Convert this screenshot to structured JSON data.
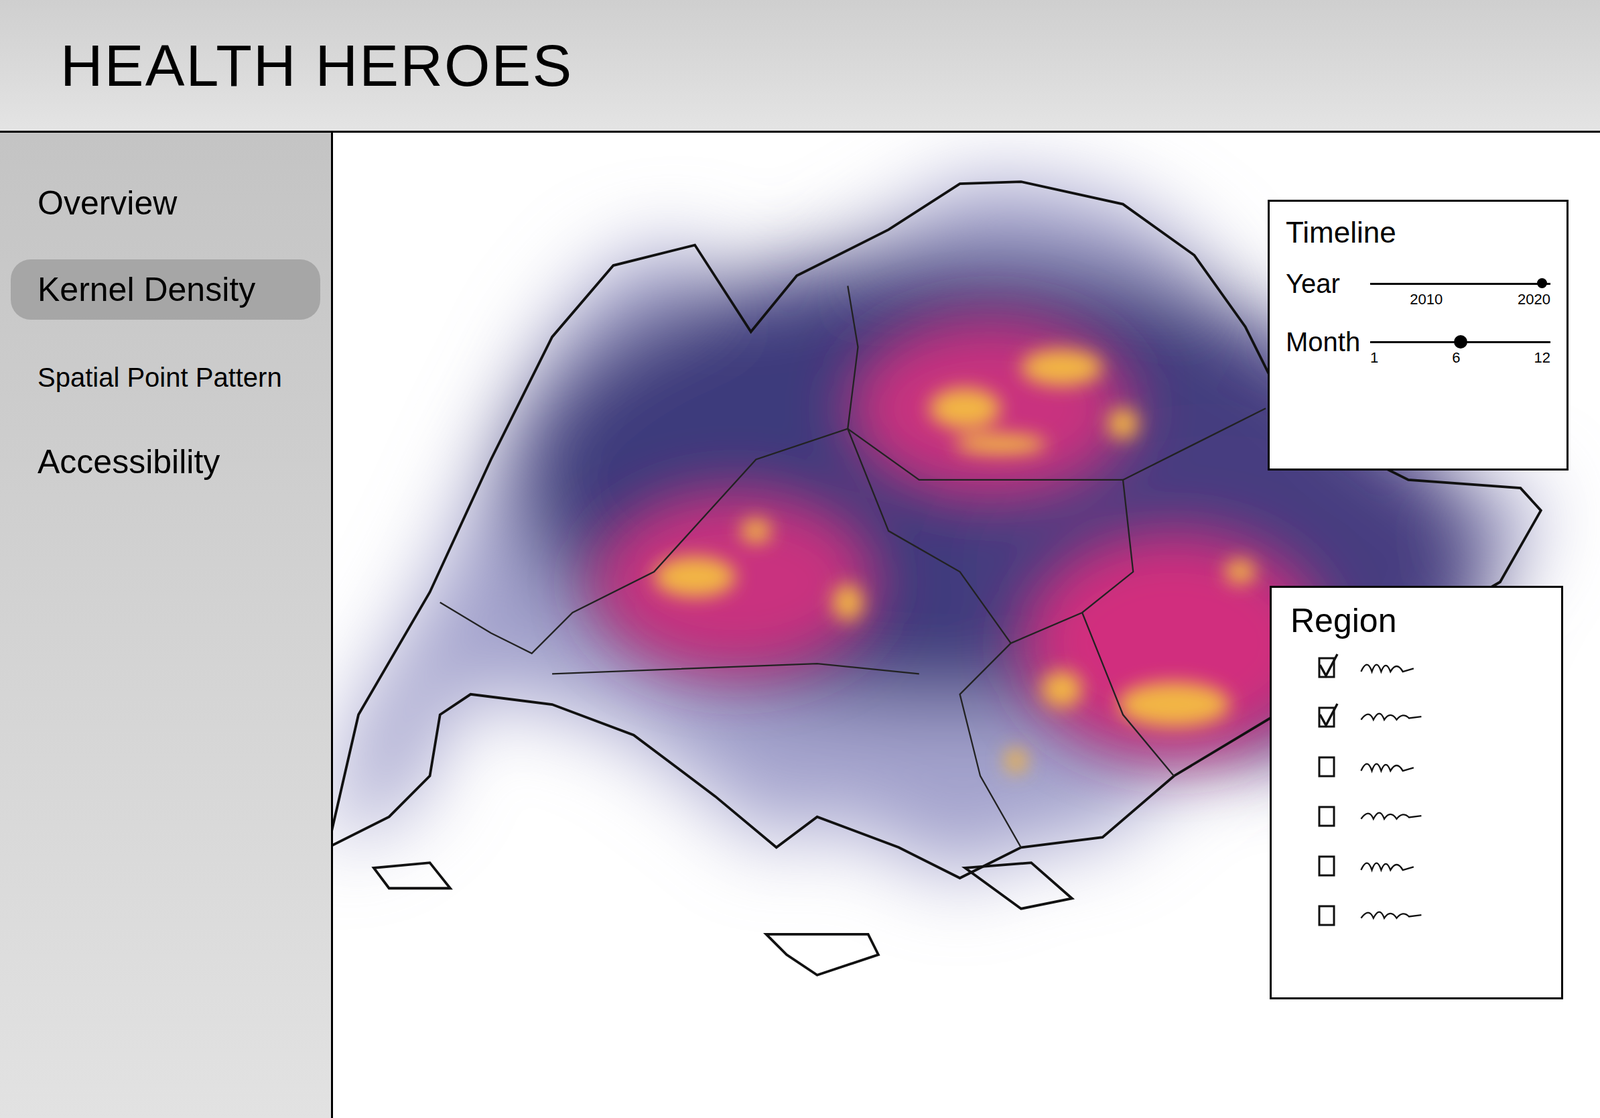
{
  "app": {
    "title": "HEALTH HEROES"
  },
  "sidebar": {
    "items": [
      {
        "label": "Overview",
        "selected": false
      },
      {
        "label": "Kernel Density",
        "selected": true
      },
      {
        "label": "Spatial Point Pattern",
        "selected": false
      },
      {
        "label": "Accessibility",
        "selected": false
      }
    ]
  },
  "timeline": {
    "title": "Timeline",
    "sliders": [
      {
        "label": "Year",
        "ticks": [
          "2010",
          "2020"
        ],
        "level": 0.95
      },
      {
        "label": "Month",
        "ticks": [
          "1",
          "6",
          "12"
        ],
        "level": 0.5
      }
    ]
  },
  "region": {
    "title": "Region",
    "items": [
      {
        "checked": true
      },
      {
        "checked": true
      },
      {
        "checked": false
      },
      {
        "checked": false
      },
      {
        "checked": false
      },
      {
        "checked": false
      }
    ]
  }
}
